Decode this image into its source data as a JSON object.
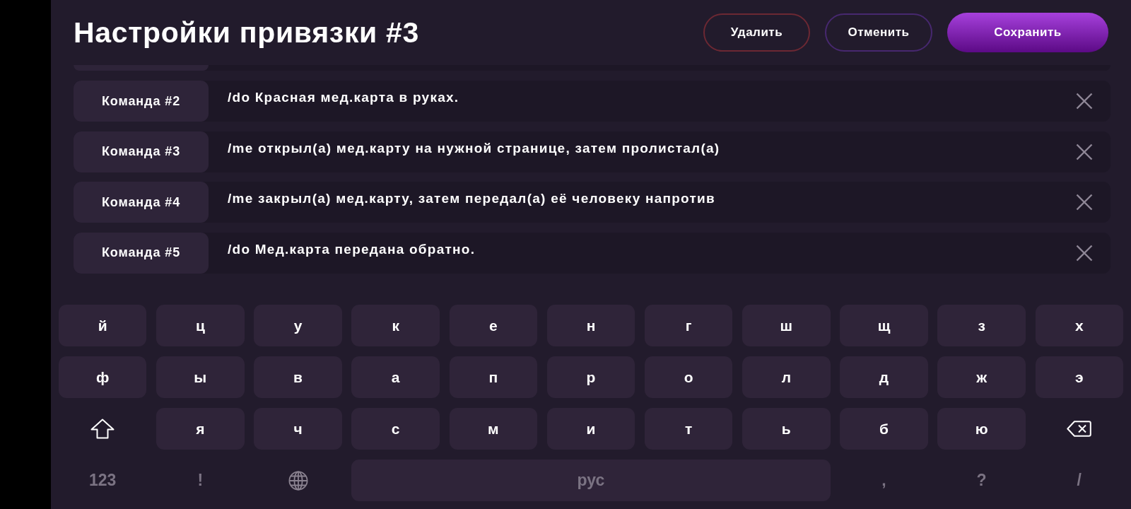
{
  "header": {
    "title": "Настройки привязки #3",
    "buttons": [
      {
        "kind": "delete",
        "label": "Удалить"
      },
      {
        "kind": "cancel",
        "label": "Отменить"
      },
      {
        "kind": "save",
        "label": "Сохранить"
      }
    ]
  },
  "commands": [
    {
      "label": "Команда #2",
      "text": "/do Красная мед.карта в руках."
    },
    {
      "label": "Команда #3",
      "text": "/me открыл(а) мед.карту на нужной странице, затем пролистал(а)"
    },
    {
      "label": "Команда #4",
      "text": "/me закрыл(а) мед.карту, затем передал(а) её человеку напротив"
    },
    {
      "label": "Команда #5",
      "text": "/do Мед.карта передана обратно."
    }
  ],
  "keyboard": {
    "rows": [
      [
        {
          "kind": "letter",
          "label": "й"
        },
        {
          "kind": "letter",
          "label": "ц"
        },
        {
          "kind": "letter",
          "label": "у"
        },
        {
          "kind": "letter",
          "label": "к"
        },
        {
          "kind": "letter",
          "label": "е"
        },
        {
          "kind": "letter",
          "label": "н"
        },
        {
          "kind": "letter",
          "label": "г"
        },
        {
          "kind": "letter",
          "label": "ш"
        },
        {
          "kind": "letter",
          "label": "щ"
        },
        {
          "kind": "letter",
          "label": "з"
        },
        {
          "kind": "letter",
          "label": "х"
        }
      ],
      [
        {
          "kind": "letter",
          "label": "ф"
        },
        {
          "kind": "letter",
          "label": "ы"
        },
        {
          "kind": "letter",
          "label": "в"
        },
        {
          "kind": "letter",
          "label": "а"
        },
        {
          "kind": "letter",
          "label": "п"
        },
        {
          "kind": "letter",
          "label": "р"
        },
        {
          "kind": "letter",
          "label": "о"
        },
        {
          "kind": "letter",
          "label": "л"
        },
        {
          "kind": "letter",
          "label": "д"
        },
        {
          "kind": "letter",
          "label": "ж"
        },
        {
          "kind": "letter",
          "label": "э"
        }
      ],
      [
        {
          "kind": "shift"
        },
        {
          "kind": "letter",
          "label": "я"
        },
        {
          "kind": "letter",
          "label": "ч"
        },
        {
          "kind": "letter",
          "label": "с"
        },
        {
          "kind": "letter",
          "label": "м"
        },
        {
          "kind": "letter",
          "label": "и"
        },
        {
          "kind": "letter",
          "label": "т"
        },
        {
          "kind": "letter",
          "label": "ь"
        },
        {
          "kind": "letter",
          "label": "б"
        },
        {
          "kind": "letter",
          "label": "ю"
        },
        {
          "kind": "backspace"
        }
      ]
    ],
    "bottom_row": [
      {
        "kind": "symbol",
        "label": "123"
      },
      {
        "kind": "symbol",
        "label": "!"
      },
      {
        "kind": "globe"
      },
      {
        "kind": "space",
        "label": "рус"
      },
      {
        "kind": "symbol",
        "label": ","
      },
      {
        "kind": "symbol",
        "label": "?"
      },
      {
        "kind": "symbol",
        "label": "/"
      }
    ]
  }
}
